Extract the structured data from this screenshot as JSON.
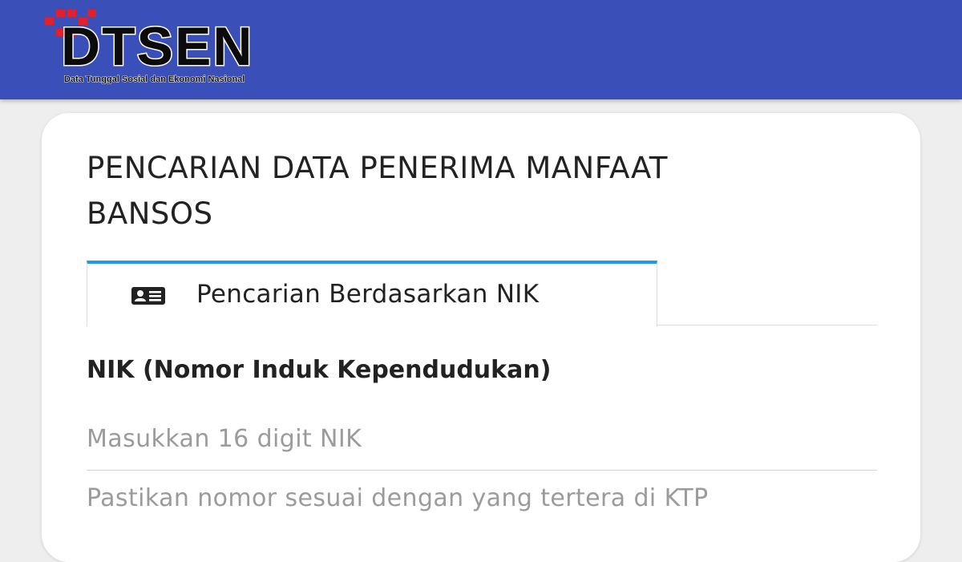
{
  "header": {
    "logo": {
      "name": "DTSEN",
      "tagline": "Data Tunggal Sosial dan Ekonomi Nasional",
      "mark_color": "#e0202a"
    },
    "background_color": "#3a50b8"
  },
  "card": {
    "title": "PENCARIAN DATA PENERIMA MANFAAT BANSOS",
    "tabs": [
      {
        "label": "Pencarian Berdasarkan NIK",
        "icon": "id-card-icon",
        "active": true,
        "accent_color": "#1e9be6"
      }
    ],
    "form": {
      "nik_label": "NIK (Nomor Induk Kependudukan)",
      "nik_value": "",
      "nik_placeholder": "Masukkan 16 digit NIK",
      "help_text": "Pastikan nomor sesuai dengan yang tertera di KTP"
    }
  }
}
